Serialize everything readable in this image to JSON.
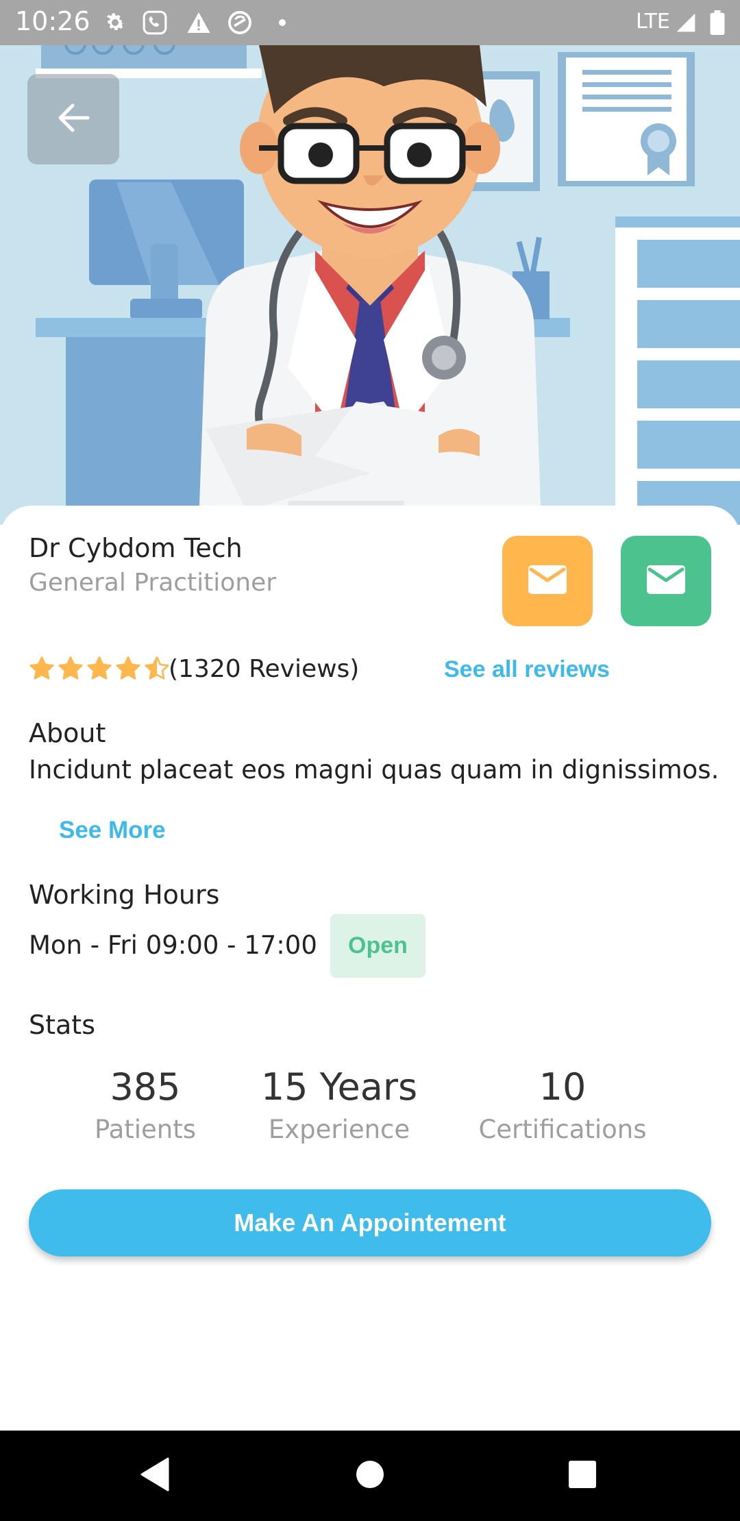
{
  "status_bar": {
    "time": "10:26",
    "network": "LTE",
    "icons": [
      "gear-icon",
      "phone-icon",
      "warning-icon",
      "sync-icon",
      "dot-icon",
      "signal-icon",
      "battery-icon"
    ]
  },
  "hero": {
    "image": "doctor-illustration",
    "back_icon": "arrow-left-icon"
  },
  "doctor": {
    "name": "Dr Cybdom Tech",
    "specialty": "General Practitioner"
  },
  "actions": {
    "email_orange_icon": "mail-icon",
    "email_green_icon": "mail-icon"
  },
  "rating": {
    "stars": 4.5,
    "reviews_text": "(1320 Reviews)",
    "see_all_label": "See all reviews"
  },
  "about": {
    "heading": "About",
    "text": "Incidunt placeat eos magni quas quam in dignissimos.",
    "see_more_label": "See More"
  },
  "working_hours": {
    "heading": "Working Hours",
    "text": "Mon - Fri 09:00 - 17:00",
    "badge": "Open"
  },
  "stats": {
    "heading": "Stats",
    "items": [
      {
        "value": "385",
        "label": "Patients"
      },
      {
        "value": "15 Years",
        "label": "Experience"
      },
      {
        "value": "10",
        "label": "Certifications"
      }
    ]
  },
  "appointment_button_label": "Make An Appointement",
  "colors": {
    "accent_blue": "#3fbcec",
    "orange": "#ffb64d",
    "green": "#4cc38f",
    "star": "#ffb64d"
  }
}
